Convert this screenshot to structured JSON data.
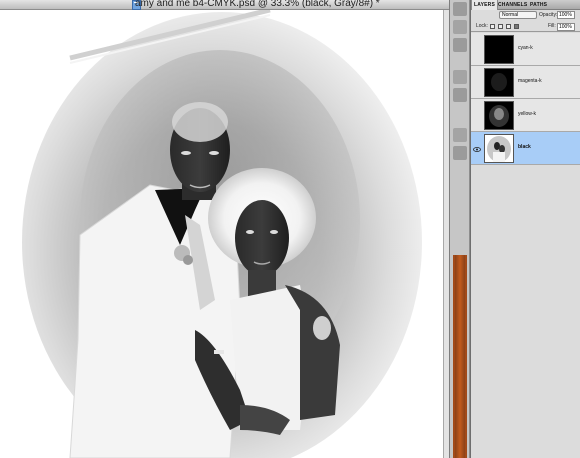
{
  "document": {
    "title": "amy and me b4-CMYK.psd @ 33.3% (black, Gray/8#) *"
  },
  "layers_panel": {
    "tabs": [
      "LAYERS",
      "CHANNELS",
      "PATHS"
    ],
    "active_tab": "LAYERS",
    "blend_mode": "Normal",
    "opacity_label": "Opacity:",
    "opacity_value": "100%",
    "lock_label": "Lock:",
    "fill_label": "Fill:",
    "fill_value": "100%",
    "layers": [
      {
        "name": "cyan-k",
        "visible": false,
        "selected": false
      },
      {
        "name": "magenta-k",
        "visible": false,
        "selected": false
      },
      {
        "name": "yellow-k",
        "visible": false,
        "selected": false
      },
      {
        "name": "black",
        "visible": true,
        "selected": true
      }
    ]
  },
  "colors": {
    "selection": "#a8cdf7",
    "panel_bg": "#dcdcdc",
    "accent_strip": "#a24a19"
  },
  "icons": [
    "document-file-icon",
    "eye-icon",
    "lock-transparent-icon",
    "lock-paint-icon",
    "lock-move-icon",
    "lock-all-icon"
  ]
}
